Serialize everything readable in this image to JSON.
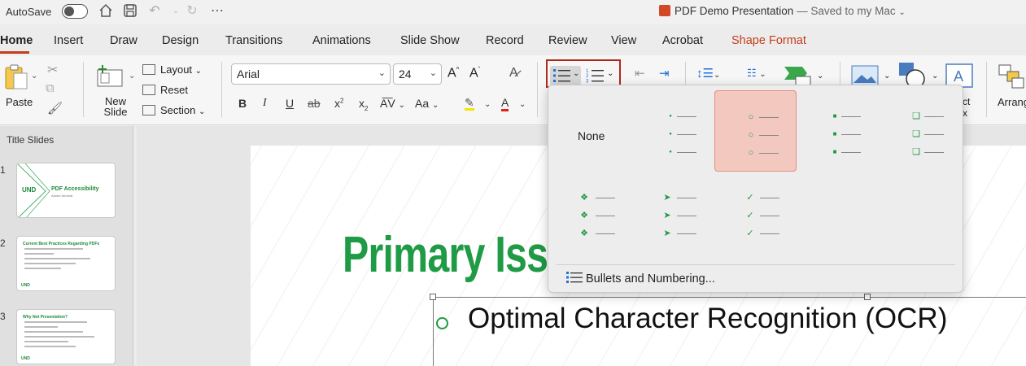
{
  "titlebar": {
    "autosave_label": "AutoSave",
    "doc_name": "PDF Demo Presentation",
    "doc_status": "— Saved to my Mac"
  },
  "tabs": [
    "Home",
    "Insert",
    "Draw",
    "Design",
    "Transitions",
    "Animations",
    "Slide Show",
    "Record",
    "Review",
    "View",
    "Acrobat",
    "Shape Format"
  ],
  "ribbon": {
    "paste": "Paste",
    "new_slide": "New Slide",
    "layout": "Layout",
    "reset": "Reset",
    "section": "Section",
    "font_name": "Arial",
    "font_size": "24",
    "arrange": "Arrang",
    "textbox_fragment": "ct x"
  },
  "bullets_menu": {
    "none_label": "None",
    "footer": "Bullets and Numbering...",
    "selected_index": 2,
    "accent_color": "#1f9a45"
  },
  "slides_panel": {
    "section": "Title Slides",
    "slides": [
      {
        "num": "1",
        "title": "PDF Accessibility",
        "subtitle": "Adobe Acrobat"
      },
      {
        "num": "2",
        "title": "Current Best Practices Regarding PDFs"
      },
      {
        "num": "3",
        "title": "Why Not Presentation?"
      }
    ]
  },
  "slide": {
    "title": "Primary Iss",
    "bullet": "Optimal Character Recognition (OCR)"
  }
}
